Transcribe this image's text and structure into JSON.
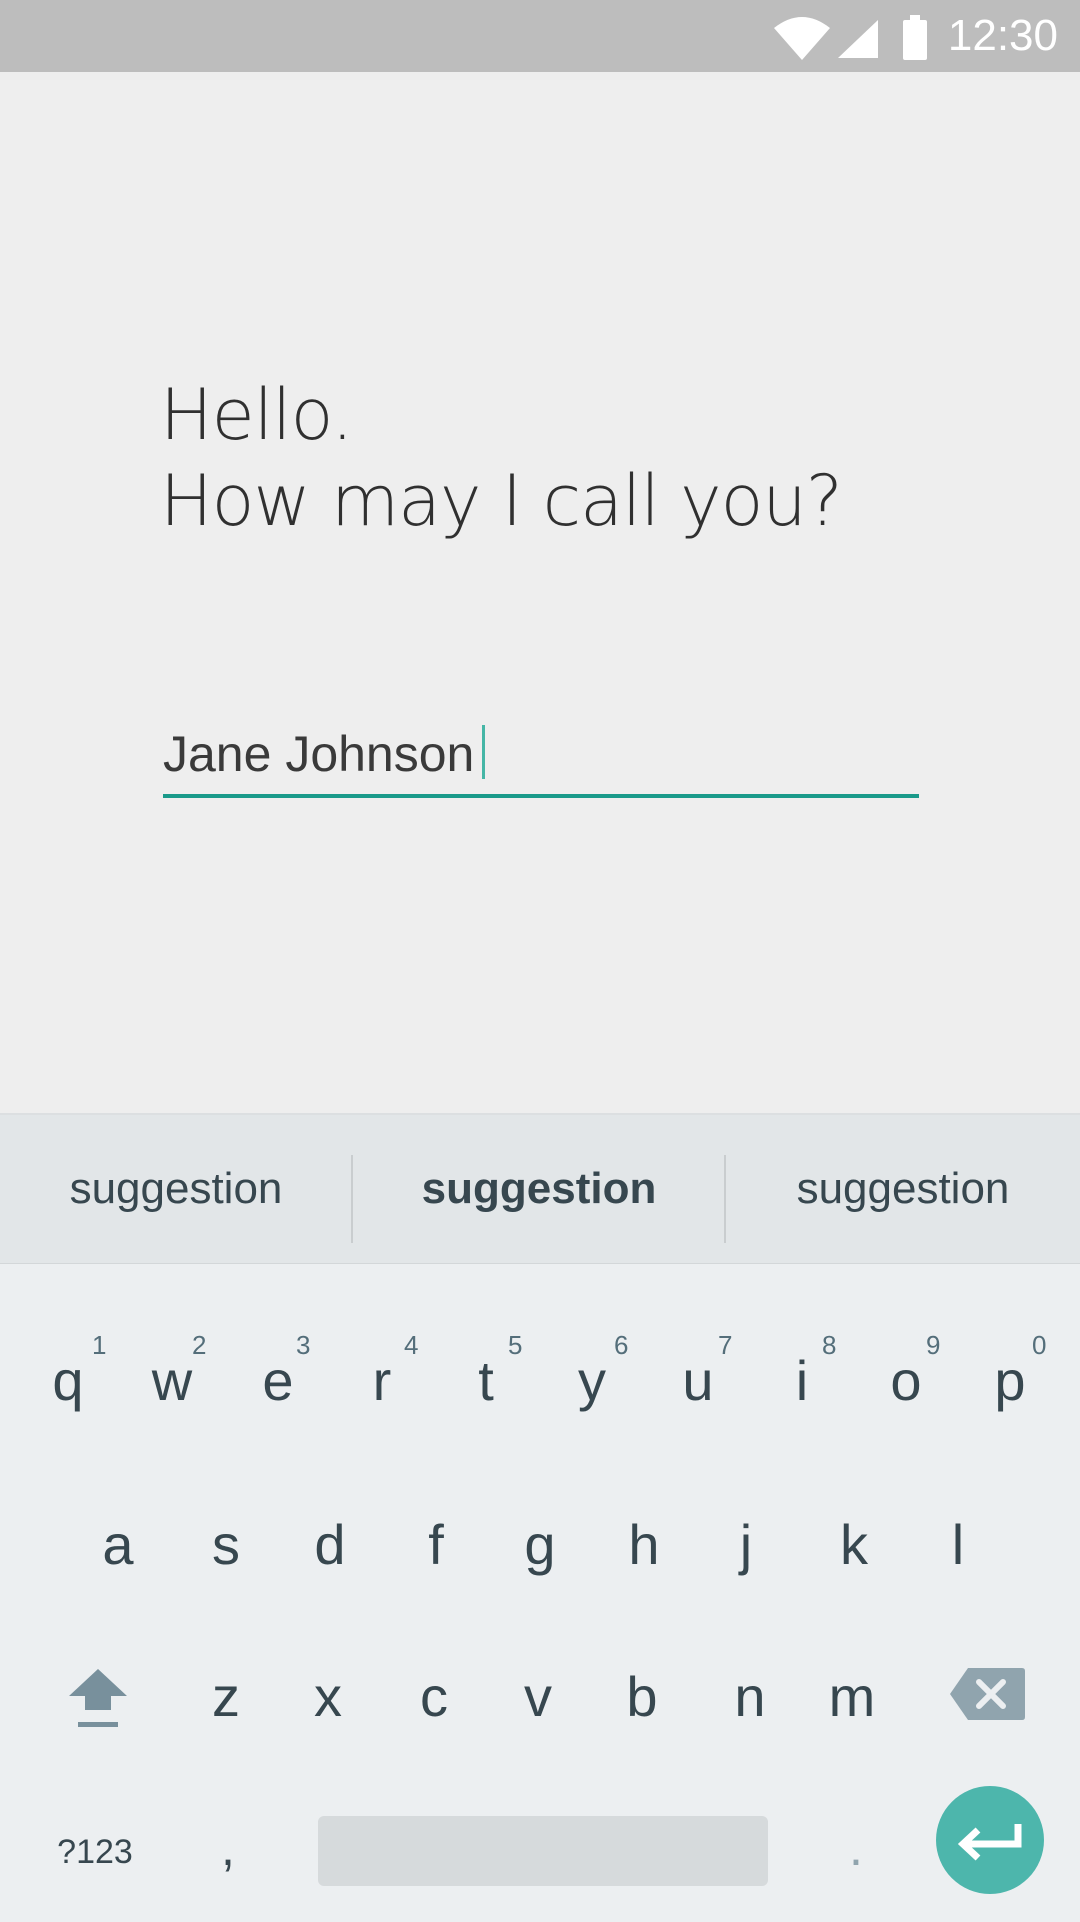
{
  "status_bar": {
    "time": "12:30",
    "icons": [
      "wifi-icon",
      "cell-signal-icon",
      "battery-icon"
    ],
    "background": "#bdbdbd"
  },
  "greeting": {
    "line1": "Hello.",
    "line2": "How may I call you?"
  },
  "name_input": {
    "value": "Jane Johnson",
    "accent_color": "#1a9a8a"
  },
  "keyboard": {
    "suggestions": [
      "suggestion",
      "suggestion",
      "suggestion"
    ],
    "row1": [
      {
        "key": "q",
        "hint": "1"
      },
      {
        "key": "w",
        "hint": "2"
      },
      {
        "key": "e",
        "hint": "3"
      },
      {
        "key": "r",
        "hint": "4"
      },
      {
        "key": "t",
        "hint": "5"
      },
      {
        "key": "y",
        "hint": "6"
      },
      {
        "key": "u",
        "hint": "7"
      },
      {
        "key": "i",
        "hint": "8"
      },
      {
        "key": "o",
        "hint": "9"
      },
      {
        "key": "p",
        "hint": "0"
      }
    ],
    "row2": [
      "a",
      "s",
      "d",
      "f",
      "g",
      "h",
      "j",
      "k",
      "l"
    ],
    "row3": [
      "z",
      "x",
      "c",
      "v",
      "b",
      "n",
      "m"
    ],
    "symbols_label": "?123",
    "comma_label": ",",
    "period_label": ".",
    "icons": {
      "shift": "shift-arrow-icon",
      "backspace": "backspace-icon",
      "enter": "enter-return-icon"
    },
    "enter_color": "#4db6ac"
  }
}
